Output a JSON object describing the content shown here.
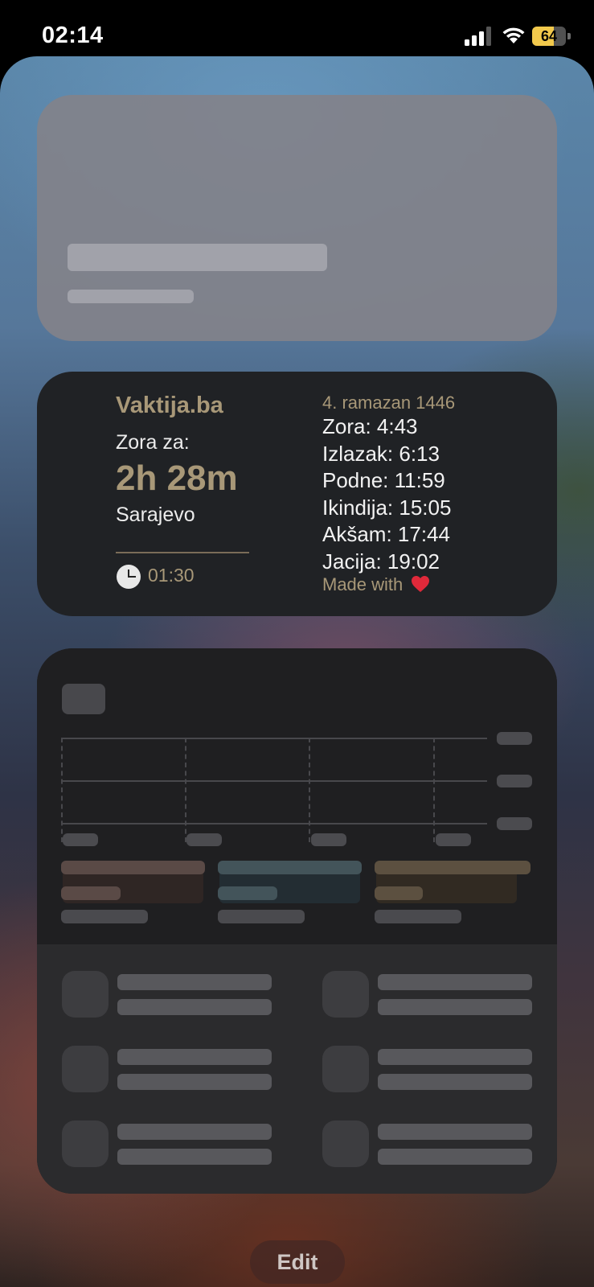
{
  "status_bar": {
    "time": "02:14",
    "battery_percent": "64",
    "battery_level": 0.64,
    "battery_color": "#f2c94c",
    "signal_icon": "cellular-signal-icon",
    "wifi_icon": "wifi-icon",
    "charging_icon": "bolt-icon"
  },
  "vaktija_widget": {
    "title": "Vaktija.ba",
    "next_label": "Zora za:",
    "countdown": "2h 28m",
    "city": "Sarajevo",
    "updated_time": "01:30",
    "hijri_date": "4. ramazan 1446",
    "prayer_times": [
      "Zora: 4:43",
      "Izlazak: 6:13",
      "Podne: 11:59",
      "Ikindija: 15:05",
      "Akšam: 17:44",
      "Jacija: 19:02"
    ],
    "made_with": "Made with",
    "accent_color": "#a89878"
  },
  "edit_button": {
    "label": "Edit"
  }
}
